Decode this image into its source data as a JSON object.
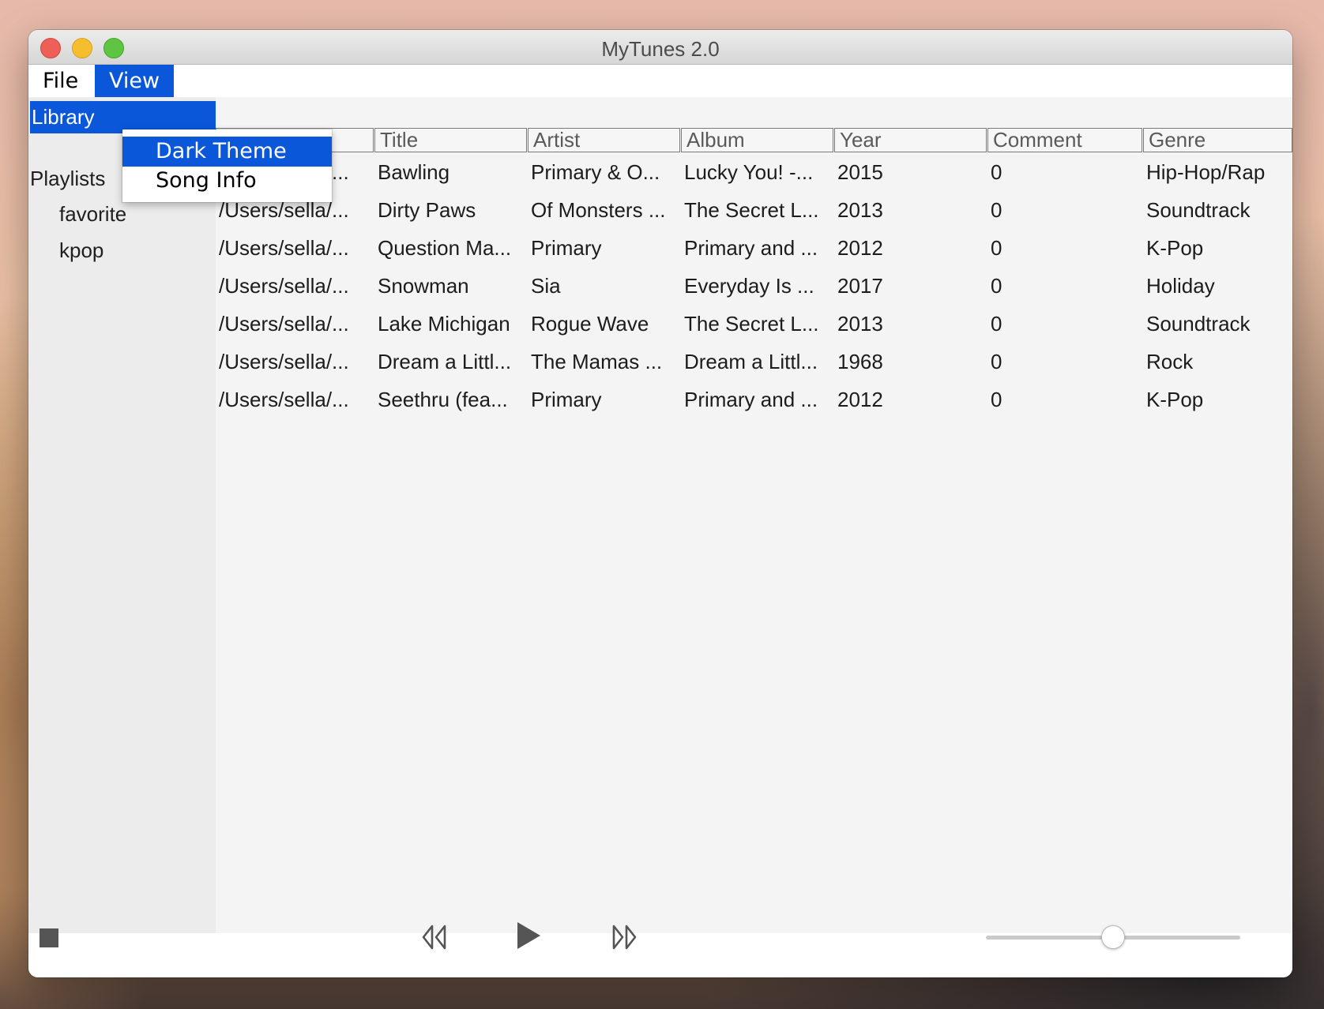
{
  "window": {
    "title": "MyTunes 2.0"
  },
  "menubar": {
    "file": "File",
    "view": "View"
  },
  "view_menu": {
    "items": [
      "Dark Theme",
      "Song Info"
    ],
    "highlighted": "Dark Theme"
  },
  "sidebar": {
    "library": "Library",
    "playlists": "Playlists",
    "playlist_items": [
      "favorite",
      "kpop"
    ]
  },
  "table": {
    "columns": [
      "",
      "Title",
      "Artist",
      "Album",
      "Year",
      "Comment",
      "Genre"
    ],
    "rows": [
      [
        "/Users/sella/...",
        "Bawling",
        "Primary & O...",
        "Lucky You! -...",
        "2015",
        "0",
        "Hip-Hop/Rap"
      ],
      [
        "/Users/sella/...",
        "Dirty Paws",
        "Of Monsters ...",
        "The Secret L...",
        "2013",
        "0",
        "Soundtrack"
      ],
      [
        "/Users/sella/...",
        "Question Ma...",
        "Primary",
        "Primary and ...",
        "2012",
        "0",
        "K-Pop"
      ],
      [
        "/Users/sella/...",
        "Snowman",
        "Sia",
        "Everyday Is ...",
        "2017",
        "0",
        "Holiday"
      ],
      [
        "/Users/sella/...",
        "Lake Michigan",
        "Rogue Wave",
        "The Secret L...",
        "2013",
        "0",
        "Soundtrack"
      ],
      [
        "/Users/sella/...",
        "Dream a Littl...",
        "The Mamas ...",
        "Dream a Littl...",
        "1968",
        "0",
        "Rock"
      ],
      [
        "/Users/sella/...",
        "Seethru (fea...",
        "Primary",
        "Primary and ...",
        "2012",
        "0",
        "K-Pop"
      ]
    ]
  },
  "player": {
    "icons": [
      "stop-icon",
      "previous-icon",
      "play-icon",
      "next-icon"
    ],
    "volume_fraction": 0.5
  },
  "colors": {
    "selection": "#0b57d9",
    "traffic_close": "#ee5f57",
    "traffic_minimize": "#f5be2e",
    "traffic_maximize": "#5fc442"
  }
}
